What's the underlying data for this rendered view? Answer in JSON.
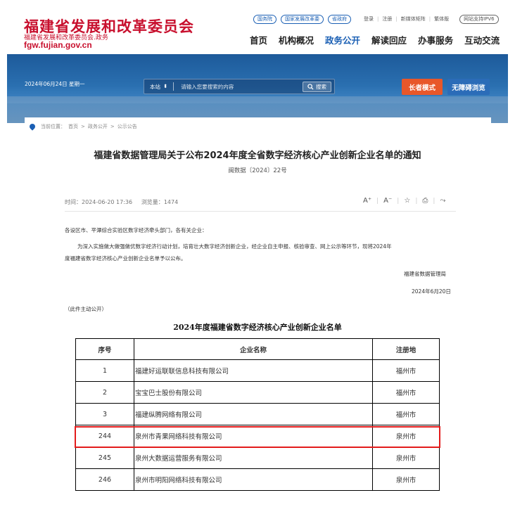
{
  "site": {
    "name": "福建省发展和改革委员会",
    "sub": "福建省发展和改革委员会.政务",
    "domain": "fgw.fujian.gov.cn"
  },
  "top_buttons": [
    "国务院",
    "国家发展改革委",
    "省政府"
  ],
  "top_links": {
    "login": "登录",
    "register": "注册",
    "matrix": "新媒体矩阵",
    "trad": "繁体版",
    "ipv6": "网站支持IPV6"
  },
  "nav": [
    "首页",
    "机构概况",
    "政务公开",
    "解读回应",
    "办事服务",
    "互动交流"
  ],
  "nav_active_index": 2,
  "banner": {
    "date": "2024年06月24日 星期一",
    "search_scope": "本站",
    "search_scope_arrow": "⬍",
    "search_placeholder": "请输入您要搜索的内容",
    "search_btn": "搜索",
    "elder_mode": "长者模式",
    "accessible": "无障碍浏览"
  },
  "breadcrumb": [
    "当前位置：",
    "首页",
    "政务公开",
    "公示公告"
  ],
  "article": {
    "title": "福建省数据管理局关于公布2024年度全省数字经济核心产业创新企业名单的通知",
    "doc_no": "闽数据〔2024〕22号",
    "time_label": "时间：",
    "time": "2024-06-20 17:36",
    "views_label": "浏览量：",
    "views": "1474",
    "tools": [
      "A⁺",
      "A⁻",
      "☆",
      "⎙",
      "⤳"
    ],
    "p1": "各设区市、平潭综合实验区数字经济牵头部门，各有关企业：",
    "p2": "为深入实施做大做强做优数字经济行动计划，培育壮大数字经济创新企业，经企业自主申报、核验审查、网上公示等环节，现将2024年",
    "p3": "度福建省数字经济核心产业创新企业名单予以公布。",
    "sign": "福建省数据管理局",
    "date": "2024年6月20日",
    "note": "（此件主动公开）"
  },
  "table": {
    "caption": "2024年度福建省数字经济核心产业创新企业名单",
    "headers": [
      "序号",
      "企业名称",
      "注册地"
    ],
    "rows": [
      [
        "1",
        "福建好运联联信息科技有限公司",
        "福州市"
      ],
      [
        "2",
        "宝宝巴士股份有限公司",
        "福州市"
      ],
      [
        "3",
        "福建纵腾网络有限公司",
        "福州市"
      ],
      [
        "244",
        "泉州市青果网络科技有限公司",
        "泉州市"
      ],
      [
        "245",
        "泉州大数据运营服务有限公司",
        "泉州市"
      ],
      [
        "246",
        "泉州市明阳网络科技有限公司",
        "泉州市"
      ]
    ],
    "highlight_row_index": 3,
    "highlight_color": "#e31b1b"
  },
  "colors": {
    "brand_red": "#c8102e",
    "link_blue": "#1a5fb4",
    "elder_orange": "#e8572a"
  }
}
